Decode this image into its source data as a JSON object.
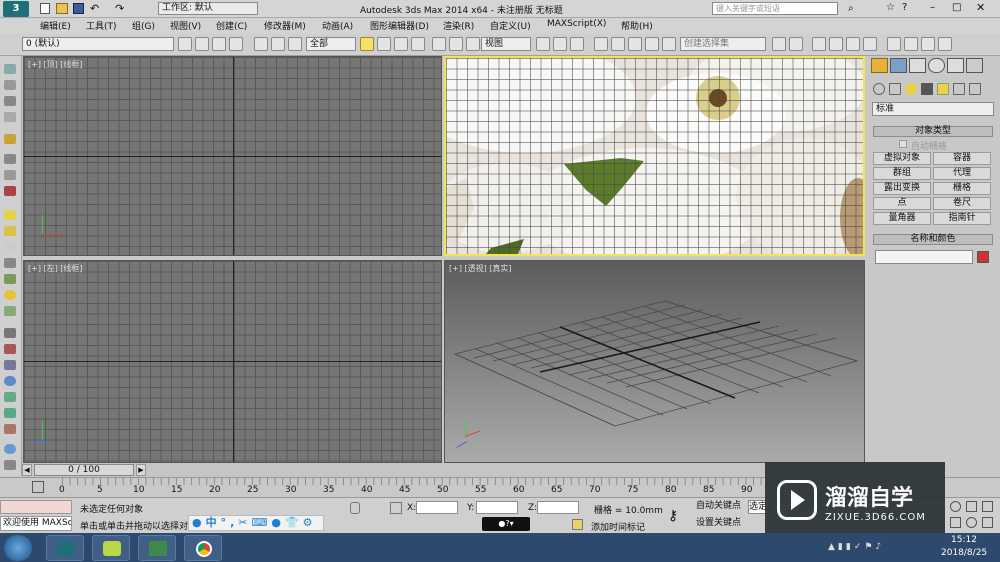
{
  "title_bar": {
    "workspace_label": "工作区: 默认",
    "title": "Autodesk 3ds Max  2014 x64  - 未注册版   无标题",
    "search_placeholder": "键入关键字或短语"
  },
  "menu": {
    "items": [
      "编辑(E)",
      "工具(T)",
      "组(G)",
      "视图(V)",
      "创建(C)",
      "修改器(M)",
      "动画(A)",
      "图形编辑器(D)",
      "渲染(R)",
      "自定义(U)",
      "MAXScript(X)",
      "帮助(H)"
    ]
  },
  "toolbar": {
    "layer_value": "0 (默认)",
    "filter_value": "全部",
    "refcoord_value": "视图",
    "selection_set_placeholder": "创建选择集"
  },
  "viewports": {
    "top_left": {
      "label": "[+] [顶] [线框]"
    },
    "top_right": {
      "label": ""
    },
    "bottom_left": {
      "label": "[+] [左] [线框]"
    },
    "bottom_right": {
      "label": "[+] [透视] [真实]"
    }
  },
  "command_panel": {
    "dropdown": "标准",
    "object_type_header": "对象类型",
    "autogrid_label": "自动栅格",
    "buttons": [
      "虚拟对象",
      "容器",
      "群组",
      "代理",
      "露出变换",
      "栅格",
      "点",
      "卷尺",
      "量角器",
      "指南针"
    ],
    "name_color_header": "名称和颜色",
    "name_color_swatch": "#cc3333"
  },
  "timeline": {
    "frame": "0 / 100"
  },
  "trackbar": {
    "ticks": [
      "0",
      "5",
      "10",
      "15",
      "20",
      "25",
      "30",
      "35",
      "40",
      "45",
      "50",
      "55",
      "60",
      "65",
      "70",
      "75",
      "80",
      "85",
      "90"
    ]
  },
  "status": {
    "welcome": "欢迎使用 MAXSc",
    "line1": "未选定任何对象",
    "line2": "单击或单击并拖动以选择对",
    "x_label": "X:",
    "y_label": "Y:",
    "z_label": "Z:",
    "grid": "栅格 = 10.0mm",
    "add_time_tag": "添加时间标记",
    "auto_key": "自动关键点",
    "set_key": "设置关键点",
    "selected": "选定对"
  },
  "taskbar": {
    "time": "15:12",
    "date": "2018/8/25"
  },
  "watermark": {
    "title": "溜溜自学",
    "url": "ZIXUE.3D66.COM"
  },
  "colors": {
    "active_border": "#f2e64a",
    "accent": "#1e7fd0"
  }
}
